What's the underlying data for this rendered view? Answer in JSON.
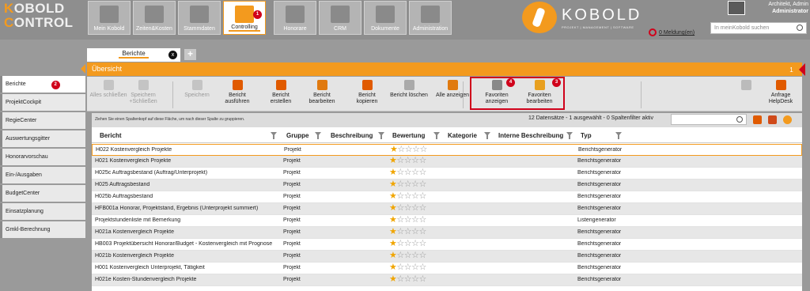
{
  "logo": {
    "line1": "KOBOLD",
    "line2": "CONTROL"
  },
  "modules": [
    {
      "label": "Mein Kobold",
      "icon": "home-icon"
    },
    {
      "label": "Zeiten&Kosten",
      "icon": "stopwatch-icon"
    },
    {
      "label": "Stammdaten",
      "icon": "hierarchy-icon"
    },
    {
      "label": "Controlling",
      "icon": "calculator-icon",
      "badge": "1"
    },
    {
      "label": "Honorare",
      "icon": "euro-docs-icon"
    },
    {
      "label": "CRM",
      "icon": "people-icon"
    },
    {
      "label": "Dokumente",
      "icon": "documents-icon"
    },
    {
      "label": "Administration",
      "icon": "gears-icon"
    }
  ],
  "brand": {
    "name": "KOBOLD",
    "tagline": "PROJEKT | MANAGEMENT | SOFTWARE"
  },
  "notification": {
    "text": "0 Meldung(en)"
  },
  "user": {
    "name": "Architekt, Admin",
    "role": "Administrator"
  },
  "search": {
    "placeholder": "In meinKobold suchen"
  },
  "doc_tab": {
    "label": "Berichte",
    "close": "x"
  },
  "tab_add": "+",
  "overview": {
    "title": "Übersicht",
    "right_badge": "1"
  },
  "sidebar": [
    {
      "label": "Berichte",
      "badge": "2"
    },
    {
      "label": "ProjektCockpit"
    },
    {
      "label": "RegieCenter"
    },
    {
      "label": "Auswertungsgitter"
    },
    {
      "label": "Honorarvorschau"
    },
    {
      "label": "Ein-/Ausgaben"
    },
    {
      "label": "BudgetCenter"
    },
    {
      "label": "Einsatzplanung"
    },
    {
      "label": "Gmkl-Berechnung"
    }
  ],
  "toolbar": [
    {
      "label": "Alles schließen",
      "icon": "close-all-icon",
      "disabled": true
    },
    {
      "label": "Speichern +Schließen",
      "icon": "save-close-icon",
      "disabled": true
    },
    {
      "label": "Speichern",
      "icon": "save-icon",
      "disabled": true
    },
    {
      "label": "Bericht ausführen",
      "icon": "run-report-icon"
    },
    {
      "label": "Bericht erstellen",
      "icon": "create-report-icon"
    },
    {
      "label": "Bericht bearbeiten",
      "icon": "edit-report-icon"
    },
    {
      "label": "Bericht kopieren",
      "icon": "copy-report-icon"
    },
    {
      "label": "Bericht löschen",
      "icon": "delete-report-icon"
    },
    {
      "label": "Alle anzeigen",
      "icon": "show-all-icon"
    },
    {
      "label": "Favoriten anzeigen",
      "icon": "show-favorites-icon",
      "badge": "4"
    },
    {
      "label": "Favoriten bearbeiten",
      "icon": "edit-favorites-icon",
      "badge": "3"
    },
    {
      "label": "",
      "icon": "settings-sun-icon"
    },
    {
      "label": "Anfrage HelpDesk",
      "icon": "helpdesk-mail-icon"
    }
  ],
  "grid": {
    "group_hint": "Ziehen Sie einen Spaltenkopf auf diese Fläche, um nach dieser Spalte zu gruppieren.",
    "record_info": "12 Datensätze - 1 ausgewählt - 0 Spaltenfilter aktiv",
    "columns": [
      "Bericht",
      "Gruppe",
      "Beschreibung",
      "Bewertung",
      "Kategorie",
      "Interne Beschreibung",
      "Typ"
    ],
    "rows": [
      {
        "bericht": "H022 Kostenvergleich Projekte",
        "gruppe": "Projekt",
        "rating": 1,
        "typ": "Berichtsgenerator"
      },
      {
        "bericht": "H021 Kostenvergleich Projekte",
        "gruppe": "Projekt",
        "rating": 1,
        "typ": "Berichtsgenerator"
      },
      {
        "bericht": "H025c Auftragsbestand (Auftrag/Unterprojekt)",
        "gruppe": "Projekt",
        "rating": 1,
        "typ": "Berichtsgenerator"
      },
      {
        "bericht": "H025 Auftragsbestand",
        "gruppe": "Projekt",
        "rating": 1,
        "typ": "Berichtsgenerator"
      },
      {
        "bericht": "H025b Auftragsbestand",
        "gruppe": "Projekt",
        "rating": 1,
        "typ": "Berichtsgenerator"
      },
      {
        "bericht": "HFB001a Honorar, Projektstand, Ergebnis (Unterprojekt summiert)",
        "gruppe": "Projekt",
        "rating": 1,
        "typ": "Berichtsgenerator"
      },
      {
        "bericht": "Projektstundenliste mit Bemerkung",
        "gruppe": "Projekt",
        "rating": 1,
        "typ": "Listengenerator"
      },
      {
        "bericht": "H021a Kostenvergleich Projekte",
        "gruppe": "Projekt",
        "rating": 1,
        "typ": "Berichtsgenerator"
      },
      {
        "bericht": "HB003 Projektübersicht Honorar/Budget - Kostenvergleich mit Prognose",
        "gruppe": "Projekt",
        "rating": 1,
        "typ": "Berichtsgenerator"
      },
      {
        "bericht": "H021b Kostenvergleich Projekte",
        "gruppe": "Projekt",
        "rating": 1,
        "typ": "Berichtsgenerator"
      },
      {
        "bericht": "H001 Kostenvergleich Unterprojekt, Tätigkeit",
        "gruppe": "Projekt",
        "rating": 1,
        "typ": "Berichtsgenerator"
      },
      {
        "bericht": "H021e Kosten-Stundenvergleich Projekte",
        "gruppe": "Projekt",
        "rating": 1,
        "typ": "Berichtsgenerator"
      }
    ]
  },
  "colors": {
    "accent": "#f39a1e",
    "badge": "#d0021b"
  }
}
